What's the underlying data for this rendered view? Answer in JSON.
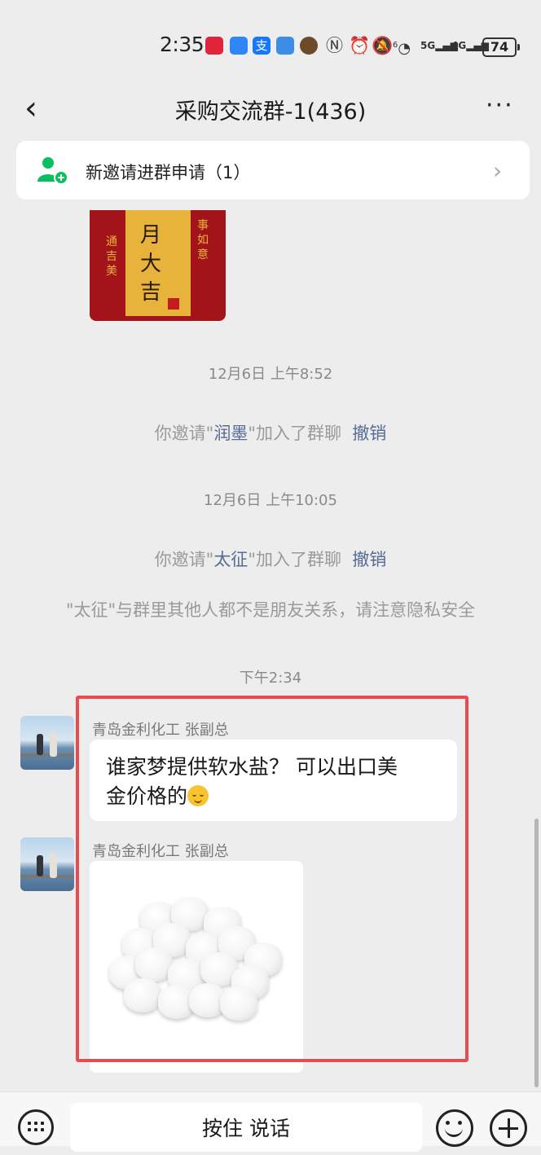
{
  "status_bar": {
    "time": "2:35",
    "signal_5g": "5G",
    "signal_4g": "4G",
    "wifi_label": "6",
    "battery": "74"
  },
  "nav": {
    "back_icon": "‹",
    "title": "采购交流群-1(436)",
    "more_icon": "···"
  },
  "banner": {
    "text": "新邀请进群申请（1）",
    "chevron": "›"
  },
  "calendar_image": {
    "center_line_1": "月",
    "center_line_2": "大",
    "center_line_3": "吉",
    "left_text": "通吉美",
    "right_text": "事如意"
  },
  "timeline": [
    {
      "timestamp": "12月6日 上午8:52",
      "prefix": "你邀请\"",
      "name": "润墨",
      "suffix": "\"加入了群聊",
      "revoke": "撤销"
    },
    {
      "timestamp": "12月6日 上午10:05",
      "prefix": "你邀请\"",
      "name": "太征",
      "suffix": "\"加入了群聊",
      "revoke": "撤销"
    }
  ],
  "privacy_notice": "\"太征\"与群里其他人都不是朋友关系，请注意隐私安全",
  "time_marker": "下午2:34",
  "messages": [
    {
      "sender": "青岛金利化工 张副总",
      "line1": "谁家梦提供软水盐？ 可以出口美",
      "line2": "金价格的"
    },
    {
      "sender": "青岛金利化工 张副总",
      "image": "salt-tablets-photo"
    }
  ],
  "bottom_bar": {
    "voice_label": "按住 说话"
  },
  "colors": {
    "link": "#576b95",
    "highlight": "#ea4b4f",
    "background": "#ededed"
  }
}
